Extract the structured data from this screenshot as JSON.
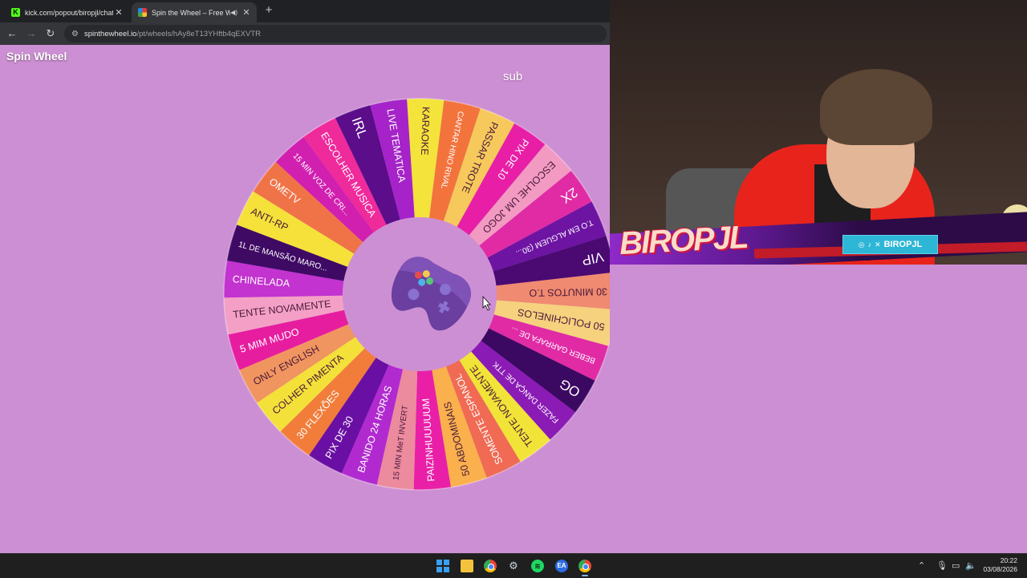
{
  "browser": {
    "tabs": [
      {
        "title": "kick.com/popout/biropjl/chat",
        "active": false
      },
      {
        "title": "Spin the Wheel – Free Whe",
        "active": true,
        "audio": true
      }
    ],
    "url": {
      "host": "spinthewheel.io",
      "path": "/pt/wheels/hAy8eT13YHftb4qEXVTR"
    }
  },
  "page": {
    "brand": "Spin Wheel",
    "wheel_title": "sub",
    "center_icon": "gamepad-icon"
  },
  "wheel": {
    "segments": [
      {
        "label": "30 MINUTOS T.O",
        "color": "#f08a70"
      },
      {
        "label": "50 POLICHINELOS",
        "color": "#f6d17e"
      },
      {
        "label": "BEBER GARRAFA DE ...",
        "color": "#e02ba5"
      },
      {
        "label": "OG",
        "color": "#3c0962"
      },
      {
        "label": "FAZER DANÇA DE TTK",
        "color": "#8b1bb5"
      },
      {
        "label": "TENTE NOVAMENTE",
        "color": "#f2e338"
      },
      {
        "label": "SOMENTE ESPANOL",
        "color": "#f06a54"
      },
      {
        "label": "50 ABDOMINAIS",
        "color": "#f9b04d"
      },
      {
        "label": "PAIZINHUUUUUM",
        "color": "#e91fa8"
      },
      {
        "label": "15 MIN MeT INVERT",
        "color": "#ec8a9e"
      },
      {
        "label": "BANIDO 24 HORAS",
        "color": "#b12ad0"
      },
      {
        "label": "PIX DE 30",
        "color": "#6a0fa3"
      },
      {
        "label": "30 FLEXÕES",
        "color": "#f27d3b"
      },
      {
        "label": "COLHER PIMENTA",
        "color": "#f3e13a"
      },
      {
        "label": "ONLY ENGLISH",
        "color": "#f19560"
      },
      {
        "label": "5 MIM MUDO",
        "color": "#e71d9f"
      },
      {
        "label": "TENTE NOVAMENTE",
        "color": "#f4a0c6"
      },
      {
        "label": "CHINELADA",
        "color": "#c233cf"
      },
      {
        "label": "1L DE MANSÃO MARO...",
        "color": "#3f0a64"
      },
      {
        "label": "ANTI-RP",
        "color": "#f5e13a"
      },
      {
        "label": "OMETV",
        "color": "#f07348"
      },
      {
        "label": "15 MIN VOZ DE CRI...",
        "color": "#d11fb0"
      },
      {
        "label": "ESCOLHER MUSICA",
        "color": "#ef2a9b"
      },
      {
        "label": "IRL",
        "color": "#5b0d8a"
      },
      {
        "label": "LIVE TEMATICA",
        "color": "#a523c8"
      },
      {
        "label": "KARAOKE",
        "color": "#f3e33b"
      },
      {
        "label": "CANTAR HINO RIVAL",
        "color": "#f3733d"
      },
      {
        "label": "PASSAR TROTE",
        "color": "#f7c95c"
      },
      {
        "label": "PIX DE 10",
        "color": "#e81fa6"
      },
      {
        "label": "ESCOLHE UM JOGO",
        "color": "#f29ac2"
      },
      {
        "label": "2X",
        "color": "#e02ba5"
      },
      {
        "label": "T.O EM ALGUEM (30...",
        "color": "#6d14a3"
      },
      {
        "label": "VIP",
        "color": "#4a0a72"
      }
    ],
    "rotation_deg": 359
  },
  "overlay": {
    "logo_text": "BIROPJL",
    "social_handle": "BIROPJL",
    "social_icons": [
      "instagram-icon",
      "tiktok-icon",
      "x-icon"
    ]
  },
  "taskbar": {
    "time": "20:22",
    "date": "03/08/2026"
  }
}
